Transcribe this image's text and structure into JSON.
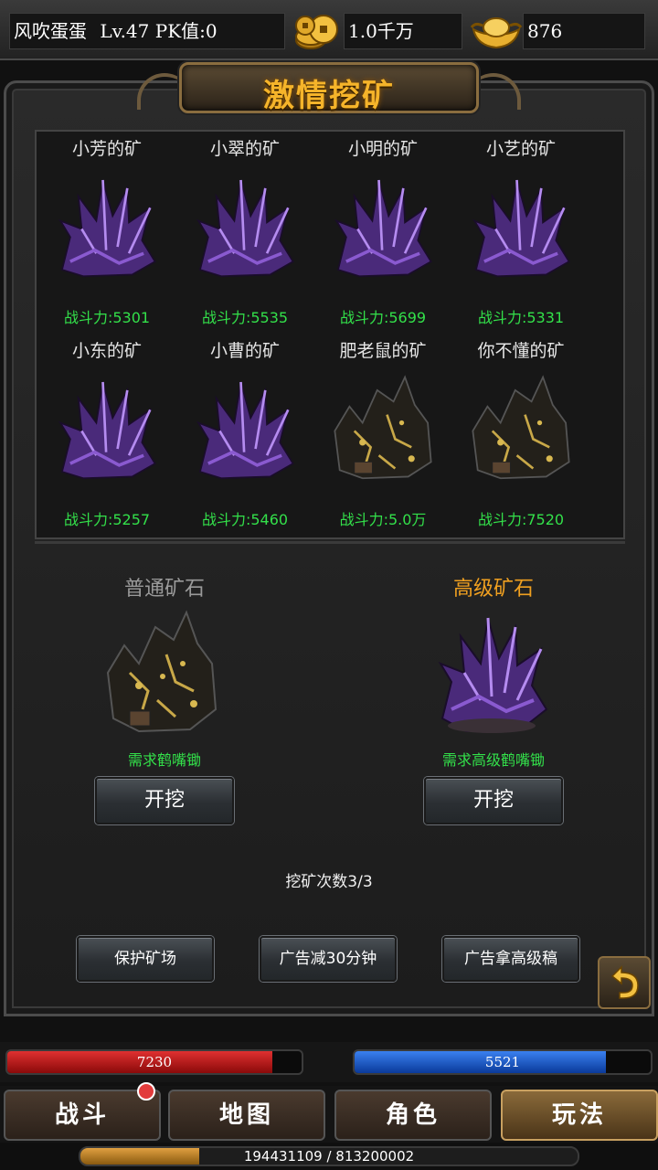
{
  "header": {
    "player": "风吹蛋蛋",
    "level": "Lv.47",
    "pk": "PK值:0",
    "gold": "1.0千万",
    "ingot": "876"
  },
  "title": "激情挖矿",
  "mines": [
    {
      "name": "小芳的矿",
      "power": "战斗力:5301",
      "type": "purple-crystal"
    },
    {
      "name": "小翠的矿",
      "power": "战斗力:5535",
      "type": "purple-crystal"
    },
    {
      "name": "小明的矿",
      "power": "战斗力:5699",
      "type": "purple-crystal"
    },
    {
      "name": "小艺的矿",
      "power": "战斗力:5331",
      "type": "purple-crystal"
    },
    {
      "name": "小东的矿",
      "power": "战斗力:5257",
      "type": "purple-crystal"
    },
    {
      "name": "小曹的矿",
      "power": "战斗力:5460",
      "type": "purple-crystal"
    },
    {
      "name": "肥老鼠的矿",
      "power": "战斗力:5.0万",
      "type": "gold-ore"
    },
    {
      "name": "你不懂的矿",
      "power": "战斗力:7520",
      "type": "gold-ore"
    }
  ],
  "normal_ore": {
    "label": "普通矿石",
    "requirement": "需求鹤嘴锄",
    "button": "开挖",
    "label_color": "#9a9a9a"
  },
  "advanced_ore": {
    "label": "高级矿石",
    "requirement": "需求高级鹤嘴锄",
    "button": "开挖",
    "label_color": "#f0a020"
  },
  "dig_count": "挖矿次数3/3",
  "actions": {
    "protect": "保护矿场",
    "ad_reduce": "广告减30分钟",
    "ad_pick": "广告拿高级稿"
  },
  "hp": {
    "value": "7230",
    "fill": 0.9
  },
  "mp": {
    "value": "5521",
    "fill": 0.85
  },
  "tabs": [
    "战斗",
    "地图",
    "角色",
    "玩法"
  ],
  "active_tab": "玩法",
  "exp": {
    "text": "194431109 / 813200002",
    "fraction": 0.239
  },
  "colors": {
    "accent_gold": "#f5b42a",
    "power_green": "#33e04a",
    "hp_red": "#c41a1a",
    "mp_blue": "#1a5ad0"
  },
  "icons": {
    "gold": "coin-stack-icon",
    "ingot": "gold-ingot-icon",
    "back": "return-arrow-icon"
  }
}
